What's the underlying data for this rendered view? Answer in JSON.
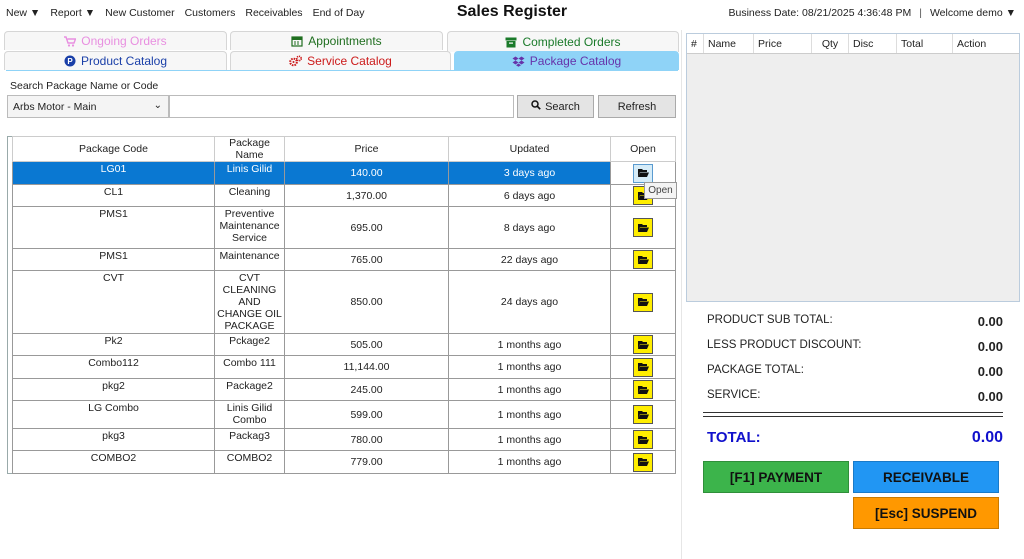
{
  "topbar": {
    "menu": [
      "New ▼",
      "Report ▼",
      "New Customer",
      "Customers",
      "Receivables",
      "End of Day"
    ],
    "title": "Sales Register",
    "business_date": "Business Date: 08/21/2025 4:36:48 PM",
    "separator": "|",
    "welcome": "Welcome demo ▼"
  },
  "tabs": {
    "ongoing": "Ongoing Orders",
    "appointments": "Appointments",
    "completed": "Completed Orders",
    "product": "Product Catalog",
    "service": "Service Catalog",
    "package": "Package Catalog"
  },
  "search": {
    "label": "Search Package Name or Code",
    "branch": "Arbs Motor - Main",
    "query": "",
    "search_btn": "Search",
    "refresh_btn": "Refresh"
  },
  "grid": {
    "headers": [
      "Package Code",
      "Package Name",
      "Price",
      "Updated",
      "Open"
    ],
    "rows": [
      {
        "code": "LG01",
        "name": "Linis Gilid",
        "price": "140.00",
        "updated": "3 days ago"
      },
      {
        "code": "CL1",
        "name": "Cleaning",
        "price": "1,370.00",
        "updated": "6 days ago"
      },
      {
        "code": "PMS1",
        "name": "Preventive Maintenance Service",
        "price": "695.00",
        "updated": "8 days ago"
      },
      {
        "code": "PMS1",
        "name": "Maintenance",
        "price": "765.00",
        "updated": "22 days ago"
      },
      {
        "code": "CVT",
        "name": "CVT CLEANING AND CHANGE OIL PACKAGE",
        "price": "850.00",
        "updated": "24 days ago"
      },
      {
        "code": "Pk2",
        "name": "Pckage2",
        "price": "505.00",
        "updated": "1 months ago"
      },
      {
        "code": "Combo112",
        "name": "Combo 111",
        "price": "11,144.00",
        "updated": "1 months ago"
      },
      {
        "code": "pkg2",
        "name": "Package2",
        "price": "245.00",
        "updated": "1 months ago"
      },
      {
        "code": "LG Combo",
        "name": "Linis Gilid Combo",
        "price": "599.00",
        "updated": "1 months ago"
      },
      {
        "code": "pkg3",
        "name": "Packag3",
        "price": "780.00",
        "updated": "1 months ago"
      },
      {
        "code": "COMBO2",
        "name": "COMBO2",
        "price": "779.00",
        "updated": "1 months ago"
      }
    ],
    "tooltip": "Open"
  },
  "cart": {
    "headers": [
      "#",
      "Name",
      "Price",
      "Qty",
      "Disc",
      "Total",
      "Action"
    ]
  },
  "summary": {
    "product_sub_total": {
      "label": "PRODUCT SUB TOTAL:",
      "value": "0.00"
    },
    "less_product_discount": {
      "label": "LESS PRODUCT DISCOUNT:",
      "value": "0.00"
    },
    "package_total": {
      "label": "PACKAGE TOTAL:",
      "value": "0.00"
    },
    "service": {
      "label": "SERVICE:",
      "value": "0.00"
    },
    "total": {
      "label": "TOTAL:",
      "value": "0.00"
    }
  },
  "buttons": {
    "payment": "[F1] PAYMENT",
    "receivable": "RECEIVABLE",
    "suspend": "[Esc] SUSPEND"
  },
  "colors": {
    "selected_row": "#0a78d2",
    "active_tab": "#8fd3f7",
    "open_button": "#ffee00",
    "payment": "#3cb44b",
    "receivable": "#2196f3",
    "suspend": "#ff9800",
    "total_text": "#1010cc"
  }
}
